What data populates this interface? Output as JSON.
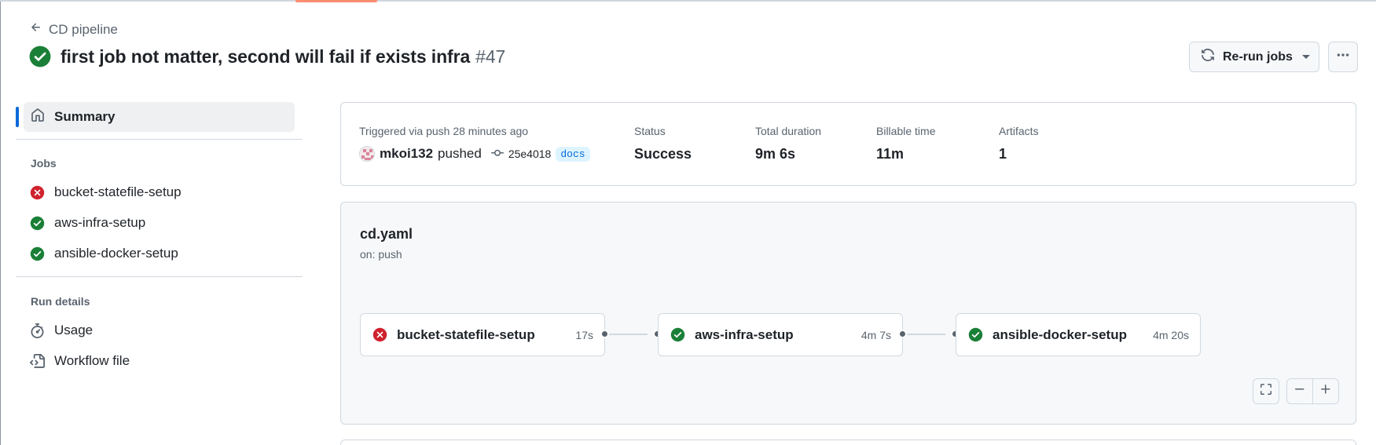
{
  "header": {
    "back_label": "CD pipeline",
    "run_title": "first job not matter, second will fail if exists infra",
    "run_number": "#47",
    "rerun_label": "Re-run jobs",
    "status": "success"
  },
  "sidebar": {
    "summary_label": "Summary",
    "jobs_heading": "Jobs",
    "jobs": [
      {
        "label": "bucket-statefile-setup",
        "status": "failure"
      },
      {
        "label": "aws-infra-setup",
        "status": "success"
      },
      {
        "label": "ansible-docker-setup",
        "status": "success"
      }
    ],
    "run_details_heading": "Run details",
    "usage_label": "Usage",
    "workflow_file_label": "Workflow file"
  },
  "summary": {
    "trigger_label": "Triggered via push 28 minutes ago",
    "actor": "mkoi132",
    "action": "pushed",
    "commit_sha": "25e4018",
    "branch": "docs",
    "status_label": "Status",
    "status_value": "Success",
    "duration_label": "Total duration",
    "duration_value": "9m 6s",
    "billable_label": "Billable time",
    "billable_value": "11m",
    "artifacts_label": "Artifacts",
    "artifacts_value": "1"
  },
  "workflow": {
    "file": "cd.yaml",
    "trigger": "on: push",
    "jobs": [
      {
        "name": "bucket-statefile-setup",
        "duration": "17s",
        "status": "failure"
      },
      {
        "name": "aws-infra-setup",
        "duration": "4m 7s",
        "status": "success"
      },
      {
        "name": "ansible-docker-setup",
        "duration": "4m 20s",
        "status": "success"
      }
    ]
  },
  "colors": {
    "success": "#1a7f37",
    "failure": "#cf222e",
    "accent": "#0969da",
    "tab_underline": "#fd8c73"
  },
  "icons": {
    "back": "arrow-left-icon",
    "success": "check-circle-fill-icon",
    "failure": "x-circle-fill-icon",
    "rerun": "sync-icon",
    "more": "kebab-horizontal-icon",
    "summary": "home-icon",
    "usage": "stopwatch-icon",
    "workflow_file": "file-code-icon",
    "commit": "git-commit-icon",
    "fullscreen": "screen-full-icon",
    "zoom_out": "dash-icon",
    "zoom_in": "plus-icon"
  }
}
